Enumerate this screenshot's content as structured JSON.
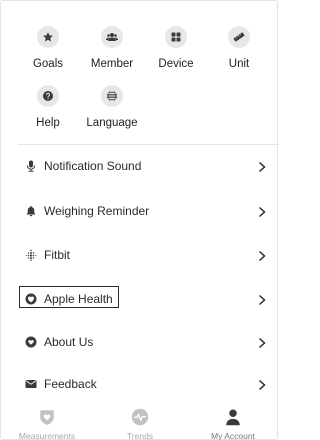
{
  "grid": {
    "row1": [
      {
        "label": "Goals",
        "icon": "star-icon"
      },
      {
        "label": "Member",
        "icon": "members-icon"
      },
      {
        "label": "Device",
        "icon": "device-grid-icon"
      },
      {
        "label": "Unit",
        "icon": "ruler-icon"
      }
    ],
    "row2": [
      {
        "label": "Help",
        "icon": "help-icon"
      },
      {
        "label": "Language",
        "icon": "globe-icon"
      }
    ]
  },
  "menu": [
    {
      "label": "Notification Sound",
      "icon": "microphone-icon"
    },
    {
      "label": "Weighing Reminder",
      "icon": "bell-icon"
    },
    {
      "label": "Fitbit",
      "icon": "fitbit-icon"
    },
    {
      "label": "Apple Health",
      "icon": "apple-health-icon"
    },
    {
      "label": "About Us",
      "icon": "about-heart-icon"
    },
    {
      "label": "Feedback",
      "icon": "mail-icon"
    }
  ],
  "tabs": [
    {
      "label": "Measurements",
      "icon": "heart-shield-icon",
      "active": false
    },
    {
      "label": "Trends",
      "icon": "pulse-icon",
      "active": false
    },
    {
      "label": "My Account",
      "icon": "person-icon",
      "active": true
    }
  ],
  "colors": {
    "icon_dark": "#3a3a3a",
    "tile_bg": "#e7e7e7",
    "tab_inactive": "#c2c2c2",
    "tab_active": "#3a3a3a"
  }
}
